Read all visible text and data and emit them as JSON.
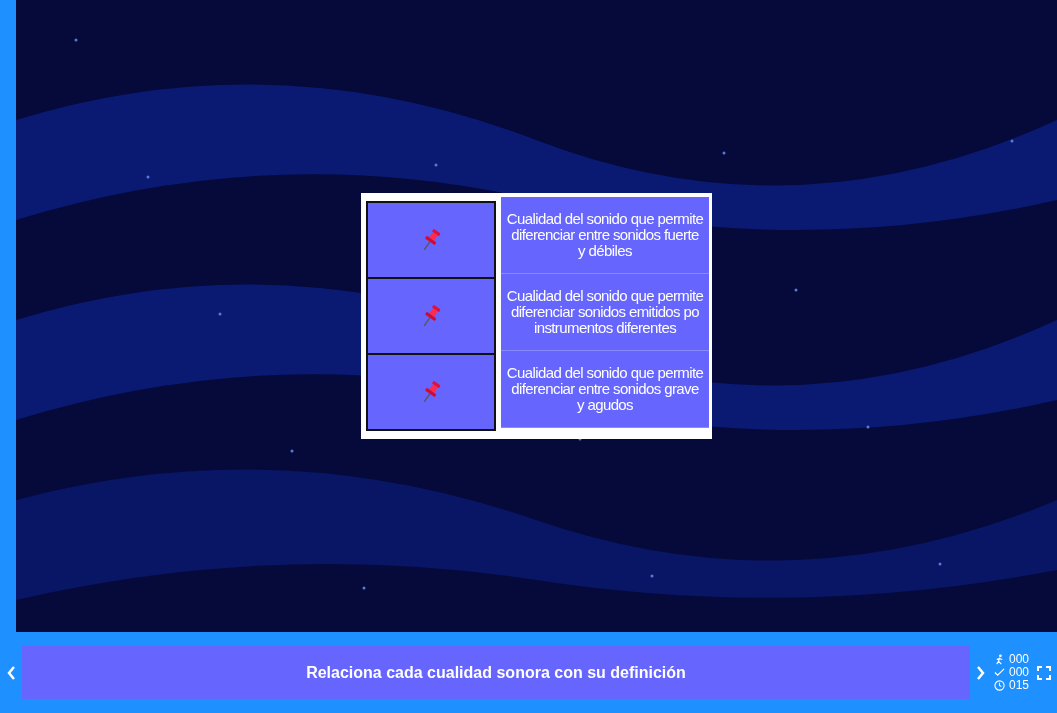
{
  "pairs": [
    {
      "definition": "Cualidad del sonido que permite\ndiferenciar entre sonidos fuerte\ny débiles"
    },
    {
      "definition": "Cualidad del sonido que permite\ndiferenciar sonidos emitidos po\ninstrumentos diferentes"
    },
    {
      "definition": "Cualidad del sonido que permite\ndiferenciar entre sonidos grave\ny agudos"
    }
  ],
  "instruction": "Relaciona cada cualidad sonora con su definición",
  "stats": {
    "moves": "000",
    "correct": "000",
    "time": "015"
  }
}
